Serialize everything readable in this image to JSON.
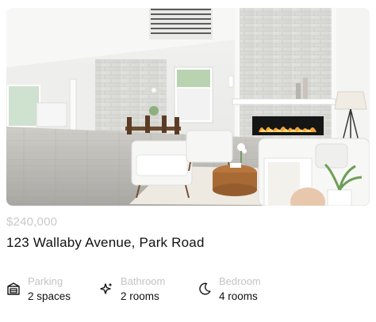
{
  "listing": {
    "price": "$240,000",
    "address": "123 Wallaby Avenue, Park Road"
  },
  "features": [
    {
      "icon": "building-icon",
      "label": "Parking",
      "value": "2 spaces"
    },
    {
      "icon": "sparkle-icon",
      "label": "Bathroom",
      "value": "2 rooms"
    },
    {
      "icon": "moon-icon",
      "label": "Bedroom",
      "value": "4 rooms"
    }
  ],
  "colors": {
    "muted_text": "#c4c4c4",
    "primary_text": "#111111",
    "background": "#ffffff"
  }
}
